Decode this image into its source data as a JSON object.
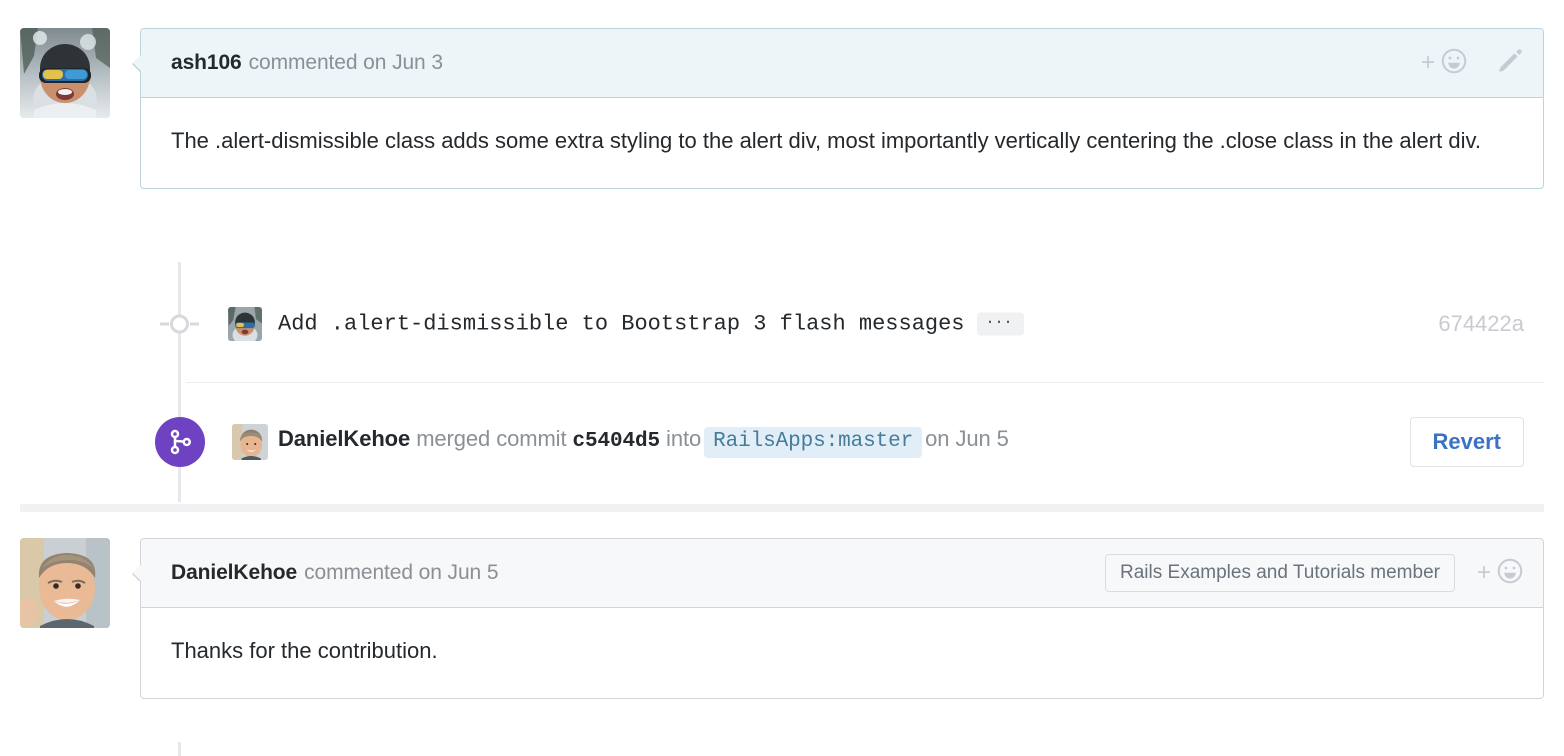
{
  "thread": {
    "comments": [
      {
        "id": "comment-ash106",
        "author": "ash106",
        "action": "commented on Jun 3",
        "body": "The .alert-dismissible class adds some extra styling to the alert div, most importantly vertically centering the .close class in the alert div.",
        "header_style": "blue",
        "avatar_name": "avatar-ash106",
        "actions": {
          "react_plus": "+",
          "react_icon": "smiley-icon",
          "edit_icon": "pencil-icon"
        }
      },
      {
        "id": "comment-danielkehoe",
        "author": "DanielKehoe",
        "action": "commented on Jun 5",
        "body": "Thanks for the contribution.",
        "header_style": "gray",
        "avatar_name": "avatar-danielkehoe",
        "membership_badge": "Rails Examples and Tutorials member",
        "actions": {
          "react_plus": "+",
          "react_icon": "smiley-icon"
        }
      }
    ],
    "commit_event": {
      "marker_icon": "commit-dot-icon",
      "avatar_name": "avatar-ash106",
      "message": "Add .alert-dismissible to Bootstrap 3 flash messages",
      "expand_label": "···",
      "sha": "674422a"
    },
    "merge_event": {
      "icon": "git-merge-icon",
      "avatar_name": "avatar-danielkehoe",
      "author": "DanielKehoe",
      "verb": "merged commit",
      "commit_sha": "c5404d5",
      "preposition": "into",
      "branch": "RailsApps:master",
      "date": "on Jun 5",
      "revert_label": "Revert"
    }
  },
  "colors": {
    "merge_purple": "#6f42c1",
    "revert_blue": "#3b73c4",
    "branch_chip_bg": "#e2eef7",
    "branch_chip_text": "#457c99",
    "comment_header_blue": "#eef5f8",
    "comment_header_gray": "#f6f8fa",
    "muted_text": "#8a9096",
    "sha_muted": "#c8cbcf"
  }
}
